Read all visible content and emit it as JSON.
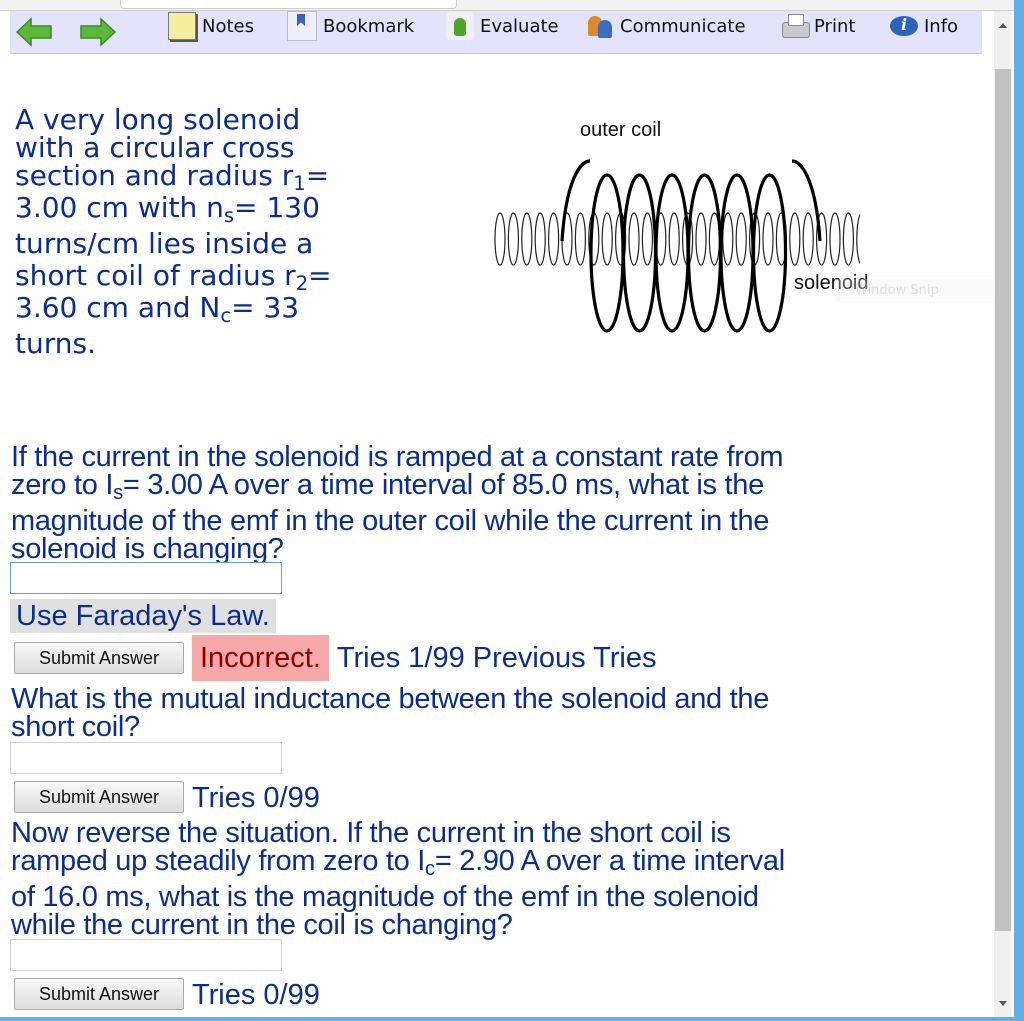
{
  "toolbar": {
    "back_icon": "green-left-arrow",
    "forward_icon": "green-right-arrow",
    "items": [
      {
        "label": "Notes",
        "icon": "notes-icon"
      },
      {
        "label": "Bookmark",
        "icon": "bookmark-icon"
      },
      {
        "label": "Evaluate",
        "icon": "thumbs-up-icon"
      },
      {
        "label": "Communicate",
        "icon": "people-icon"
      },
      {
        "label": "Print",
        "icon": "printer-icon"
      },
      {
        "label": "Info",
        "icon": "info-bubble-icon"
      }
    ]
  },
  "problem": {
    "intro_lines": [
      {
        "text": "A very long solenoid"
      },
      {
        "text": "with a circular cross"
      },
      {
        "text": "section and radius r",
        "sub": "1",
        "after": "="
      },
      {
        "text": "3.00 cm with n",
        "sub": "s",
        "after": "= 130"
      },
      {
        "text": "turns/cm lies inside a"
      },
      {
        "text": "short coil of radius r",
        "sub": "2",
        "after": "="
      },
      {
        "text": "3.60 cm and N",
        "sub": "c",
        "after": "= 33"
      },
      {
        "text": "turns."
      }
    ],
    "diagram": {
      "outer_coil_label": "outer coil",
      "solenoid_label": "solenoid"
    },
    "overlay_ghost_text": "Window Snip"
  },
  "questions": [
    {
      "lines": [
        {
          "text": "If the current in the solenoid is ramped at a constant rate from"
        },
        {
          "text": "zero to I",
          "sub": "s",
          "after": "= 3.00 A over a time interval of 85.0 ms, what is the"
        },
        {
          "text": "magnitude of the emf in the outer coil while the current in the"
        },
        {
          "text": "solenoid is changing?"
        }
      ],
      "answer_value": "",
      "hint": "Use Faraday's Law.",
      "submit_label": "Submit Answer",
      "result": "Incorrect.",
      "tries": "Tries 1/99",
      "previous_tries_label": "Previous Tries"
    },
    {
      "lines": [
        {
          "text": "What is the mutual inductance between the solenoid and the"
        },
        {
          "text": "short coil?"
        }
      ],
      "answer_value": "",
      "submit_label": "Submit Answer",
      "tries": "Tries 0/99"
    },
    {
      "lines": [
        {
          "text": "Now reverse the situation. If the current in the short coil is"
        },
        {
          "text": "ramped up steadily from zero to I",
          "sub": "c",
          "after": "= 2.90 A over a time interval"
        },
        {
          "text": "of 16.0 ms, what is the magnitude of the emf in the solenoid"
        },
        {
          "text": "while the current in the coil is changing?"
        }
      ],
      "answer_value": "",
      "submit_label": "Submit Answer",
      "tries": "Tries 0/99"
    }
  ],
  "colors": {
    "text_blue": "#0a2d8f",
    "toolbar_bg": "#e3e3fb",
    "incorrect_bg": "#f7a8a8",
    "incorrect_text": "#8a0000",
    "hint_bg": "#e0e0e0"
  }
}
